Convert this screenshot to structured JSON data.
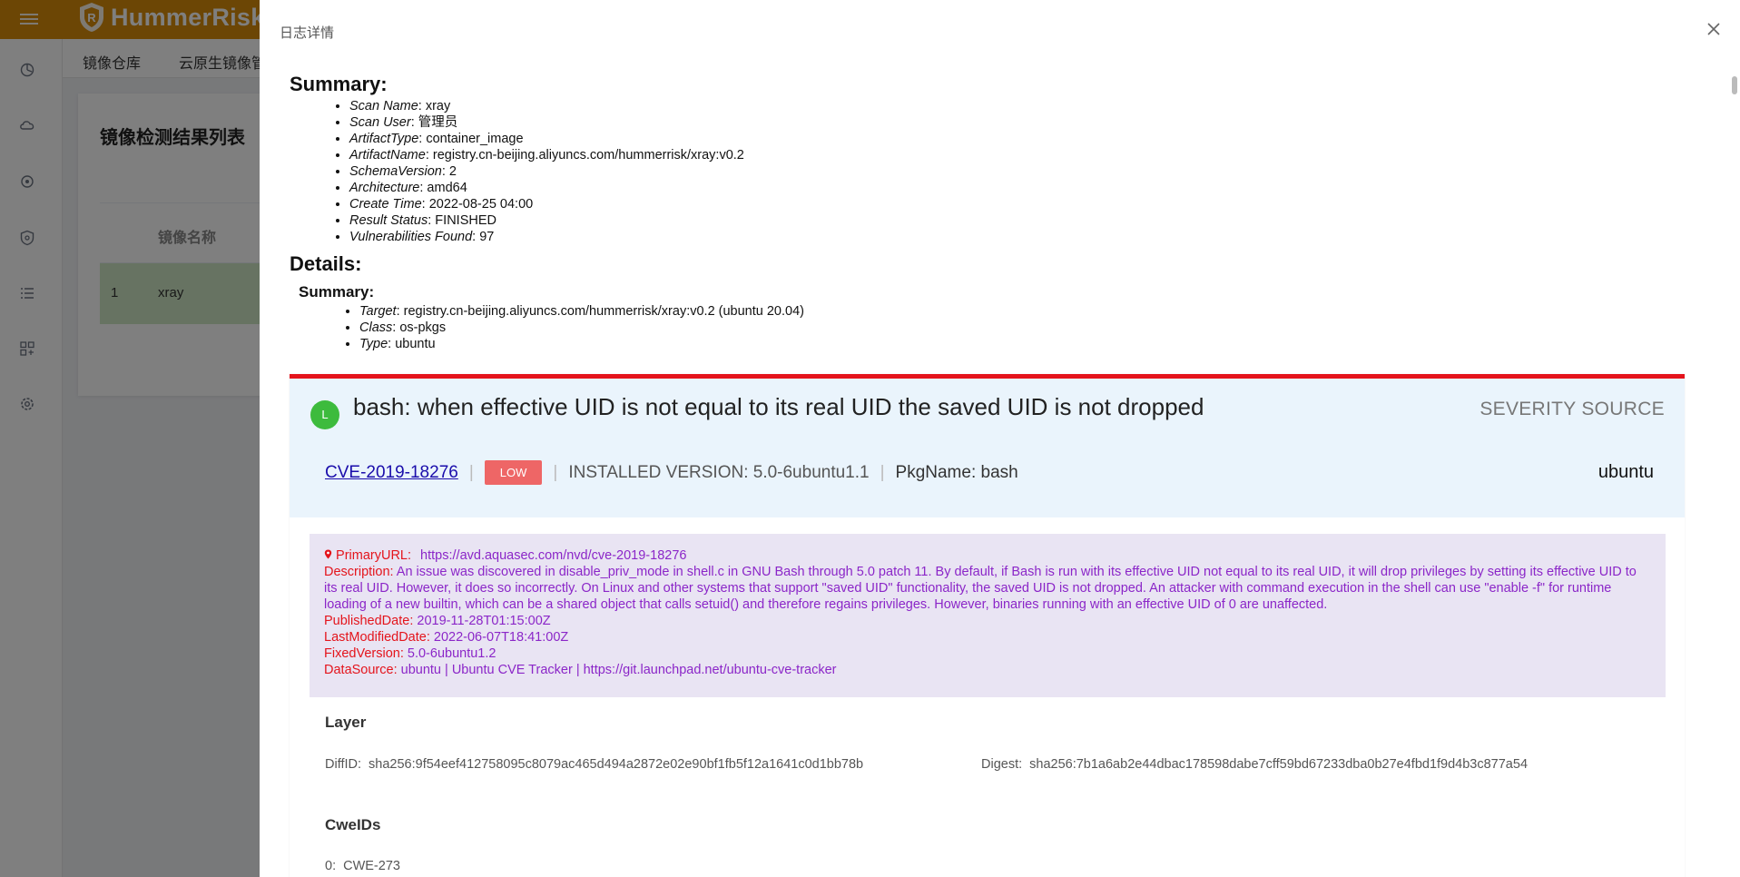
{
  "app": {
    "logo_text": "HummerRisk",
    "tabs": [
      "镜像仓库",
      "云原生镜像管"
    ],
    "card_title": "镜像检测结果列表",
    "table_header": "镜像名称",
    "table_row": {
      "index": "1",
      "name": "xray"
    }
  },
  "drawer": {
    "title": "日志详情",
    "summary_heading": "Summary:",
    "summary_items": [
      {
        "key": "Scan Name",
        "value": ": xray"
      },
      {
        "key": "Scan User",
        "value": ": 管理员"
      },
      {
        "key": "ArtifactType",
        "value": ": container_image"
      },
      {
        "key": "ArtifactName",
        "value": ": registry.cn-beijing.aliyuncs.com/hummerrisk/xray:v0.2"
      },
      {
        "key": "SchemaVersion",
        "value": ": 2"
      },
      {
        "key": "Architecture",
        "value": ": amd64"
      },
      {
        "key": "Create Time",
        "value": ": 2022-08-25 04:00"
      },
      {
        "key": "Result Status",
        "value": ": FINISHED"
      },
      {
        "key": "Vulnerabilities Found",
        "value": ": 97"
      }
    ],
    "details_heading": "Details:",
    "details_summary_heading": "Summary:",
    "details_items": [
      {
        "key": "Target",
        "value": ": registry.cn-beijing.aliyuncs.com/hummerrisk/xray:v0.2 (ubuntu 20.04)"
      },
      {
        "key": "Class",
        "value": ": os-pkgs"
      },
      {
        "key": "Type",
        "value": ": ubuntu"
      }
    ]
  },
  "vuln": {
    "badge": "L",
    "title": "bash: when effective UID is not equal to its real UID the saved UID is not dropped",
    "severity_source_label": "SEVERITY SOURCE",
    "cve_id": "CVE-2019-18276",
    "severity": "LOW",
    "installed_version": "INSTALLED VERSION: 5.0-6ubuntu1.1",
    "pkg_name": "PkgName: bash",
    "severity_source_value": "ubuntu",
    "primary_url_label": "PrimaryURL:",
    "primary_url": "https://avd.aquasec.com/nvd/cve-2019-18276",
    "description_label": "Description:",
    "description": "An issue was discovered in disable_priv_mode in shell.c in GNU Bash through 5.0 patch 11. By default, if Bash is run with its effective UID not equal to its real UID, it will drop privileges by setting its effective UID to its real UID. However, it does so incorrectly. On Linux and other systems that support \"saved UID\" functionality, the saved UID is not dropped. An attacker with command execution in the shell can use \"enable -f\" for runtime loading of a new builtin, which can be a shared object that calls setuid() and therefore regains privileges. However, binaries running with an effective UID of 0 are unaffected.",
    "published_label": "PublishedDate:",
    "published": "2019-11-28T01:15:00Z",
    "modified_label": "LastModifiedDate:",
    "modified": "2022-06-07T18:41:00Z",
    "fixed_label": "FixedVersion:",
    "fixed": "5.0-6ubuntu1.2",
    "datasource_label": "DataSource:",
    "datasource": "ubuntu | Ubuntu CVE Tracker | https://git.launchpad.net/ubuntu-cve-tracker",
    "layer_heading": "Layer",
    "diff_label": "DiffID:",
    "diff_value": "sha256:9f54eef412758095c8079ac465d494a2872e02e90bf1fb5f12a1641c0d1bb78b",
    "digest_label": "Digest:",
    "digest_value": "sha256:7b1a6ab2e44dbac178598dabe7cff59bd67233dba0b27e4fbd1f9d4b3c877a54",
    "cwe_heading": "CweIDs",
    "cwe_index": "0:",
    "cwe_value": "CWE-273"
  },
  "colors": {
    "topbar": "#d98c0a",
    "severity_bar": "#e4141c",
    "low_badge": "#ee6666",
    "level_dot": "#3dbb3d",
    "purple_text": "#8b26c8"
  }
}
